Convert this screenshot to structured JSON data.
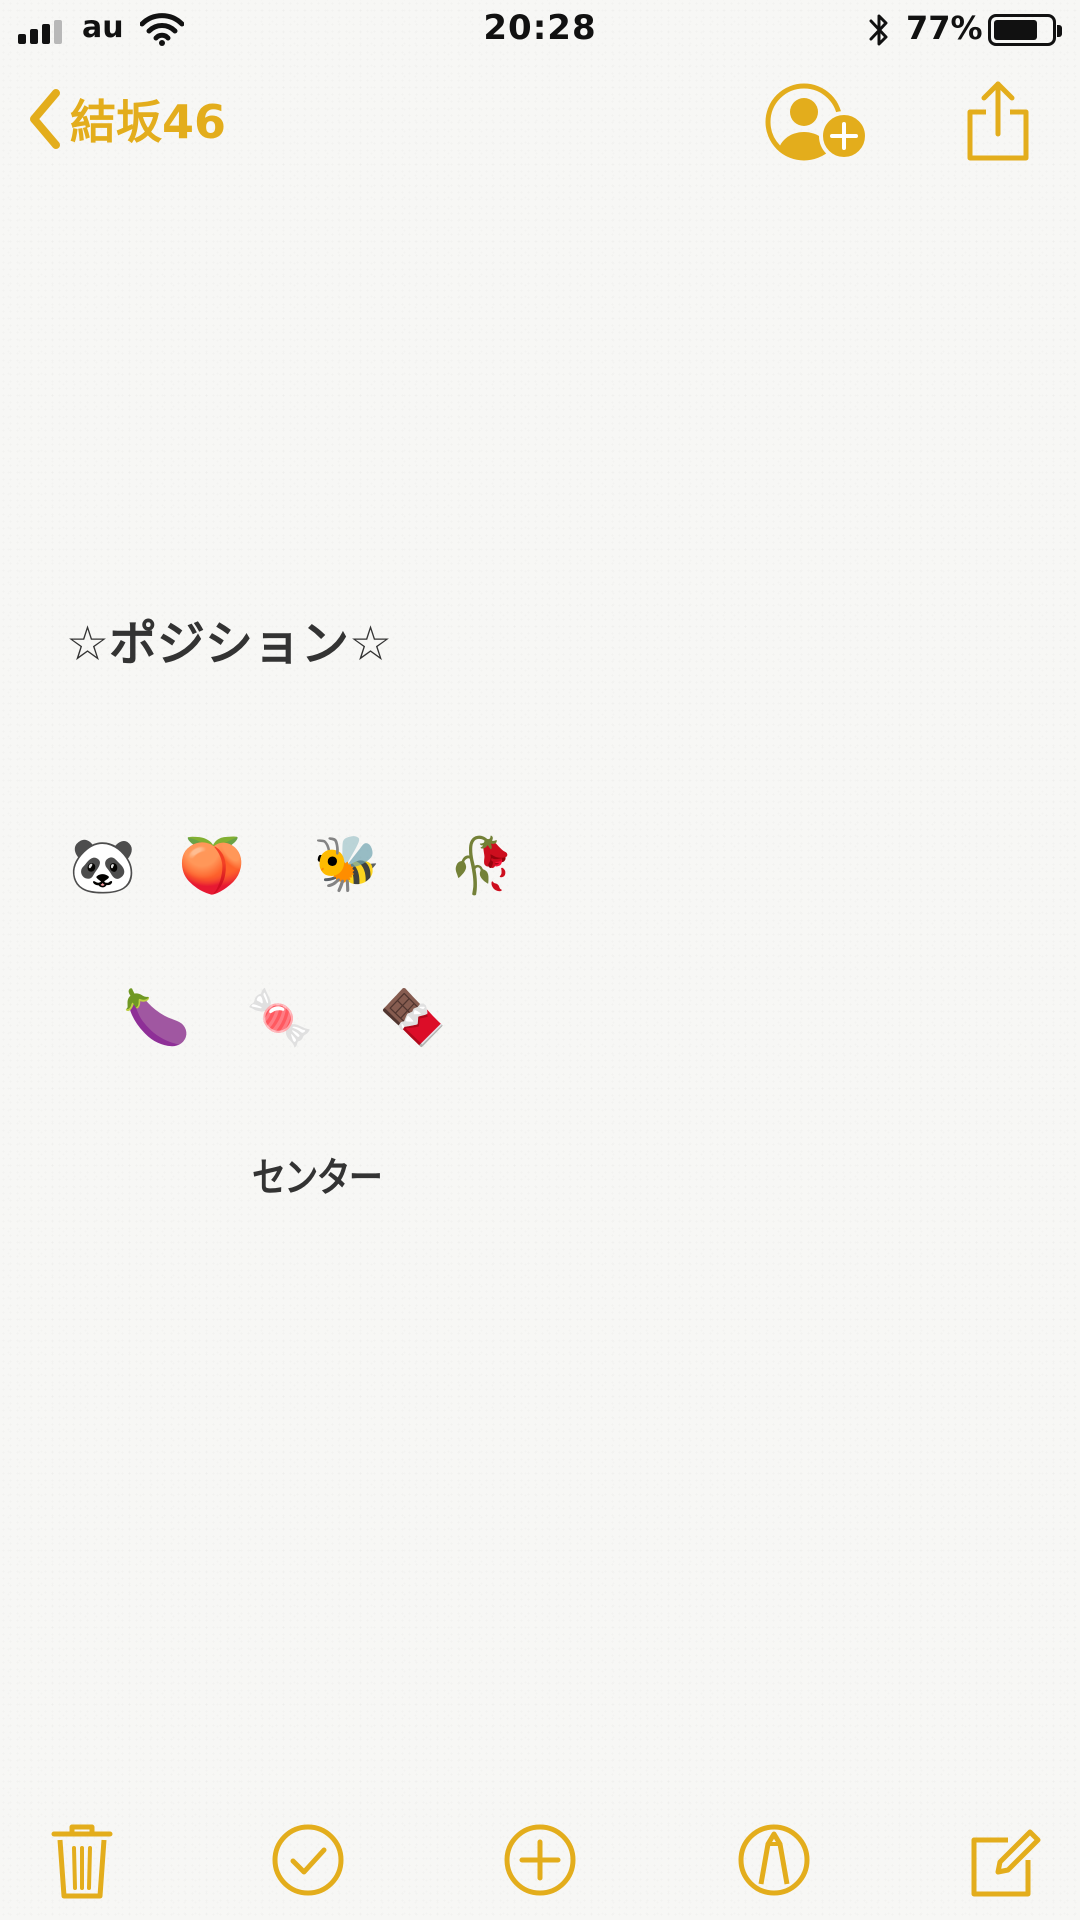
{
  "colors": {
    "accent": "#e3ad1c",
    "text": "#333333",
    "status_text": "#111111"
  },
  "status_bar": {
    "carrier": "au",
    "time": "20:28",
    "battery_percent_label": "77%",
    "battery_level": 0.77,
    "signal_bars_filled": 3,
    "signal_bars_total": 4
  },
  "nav": {
    "back_label": "結坂46",
    "back_icon": "chevron-left-icon",
    "add_person_icon": "person-add-icon",
    "share_icon": "share-icon"
  },
  "note": {
    "heading": "☆ポジション☆",
    "row1": [
      "🐼",
      "🍑",
      "🐝",
      "🥀"
    ],
    "row2": [
      "🍆",
      "🍬",
      "🍫"
    ],
    "center_label": "センター"
  },
  "toolbar": {
    "items": [
      {
        "icon": "trash-icon"
      },
      {
        "icon": "checklist-icon"
      },
      {
        "icon": "add-icon"
      },
      {
        "icon": "markup-icon"
      },
      {
        "icon": "compose-icon"
      }
    ]
  }
}
